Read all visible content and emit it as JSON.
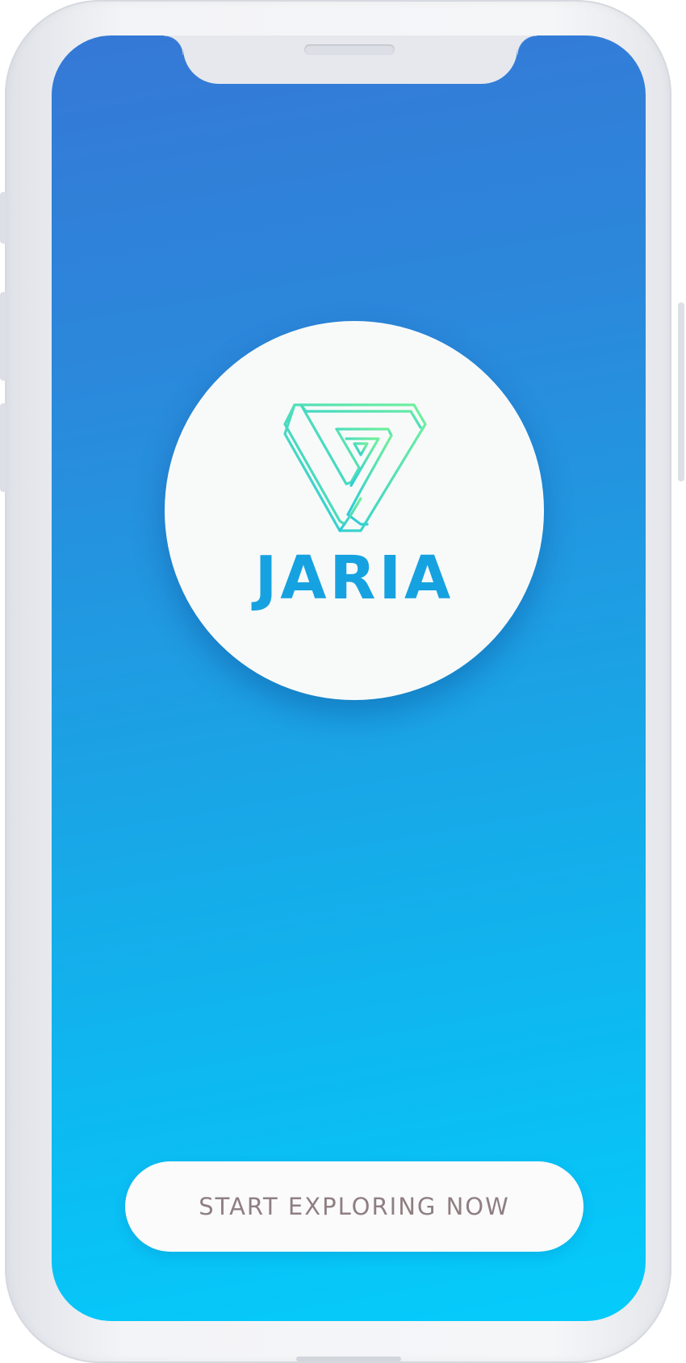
{
  "app": {
    "brand_name": "JARIA",
    "logo_icon": "impossible-triangle-icon"
  },
  "splash": {
    "cta_label": "START EXPLORING NOW"
  },
  "colors": {
    "background_top": "#3578d6",
    "background_bottom": "#04ccfb",
    "brand_text": "#16a2e0",
    "logo_gradient_start": "#2ed0d8",
    "logo_gradient_end": "#6ef09a",
    "button_bg": "#fbfbfc",
    "button_text": "#8f7f82"
  }
}
